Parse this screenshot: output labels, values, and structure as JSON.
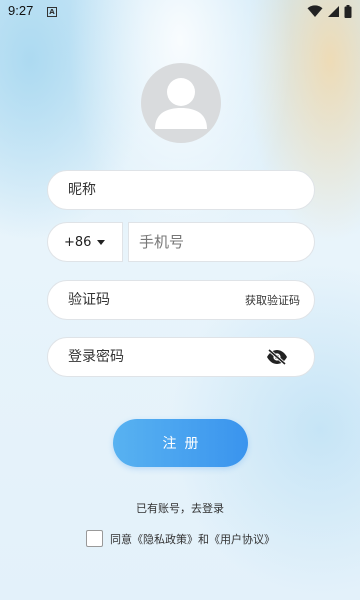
{
  "status_bar": {
    "time": "9:27",
    "notification_badge": "A",
    "icons": [
      "wifi-icon",
      "signal-icon",
      "battery-icon"
    ]
  },
  "form": {
    "nickname_placeholder": "昵称",
    "country_code": "+86",
    "phone_placeholder": "手机号",
    "code_placeholder": "验证码",
    "get_code_label": "获取验证码",
    "password_placeholder": "登录密码"
  },
  "register_label": "注册",
  "login_link": "已有账号，去登录",
  "agreement": {
    "prefix": "同意",
    "privacy": "《隐私政策》",
    "and": "和",
    "terms": "《用户协议》",
    "checked": false
  },
  "colors": {
    "accent": "#3a94ee",
    "avatar_bg": "#d9dbdd"
  }
}
